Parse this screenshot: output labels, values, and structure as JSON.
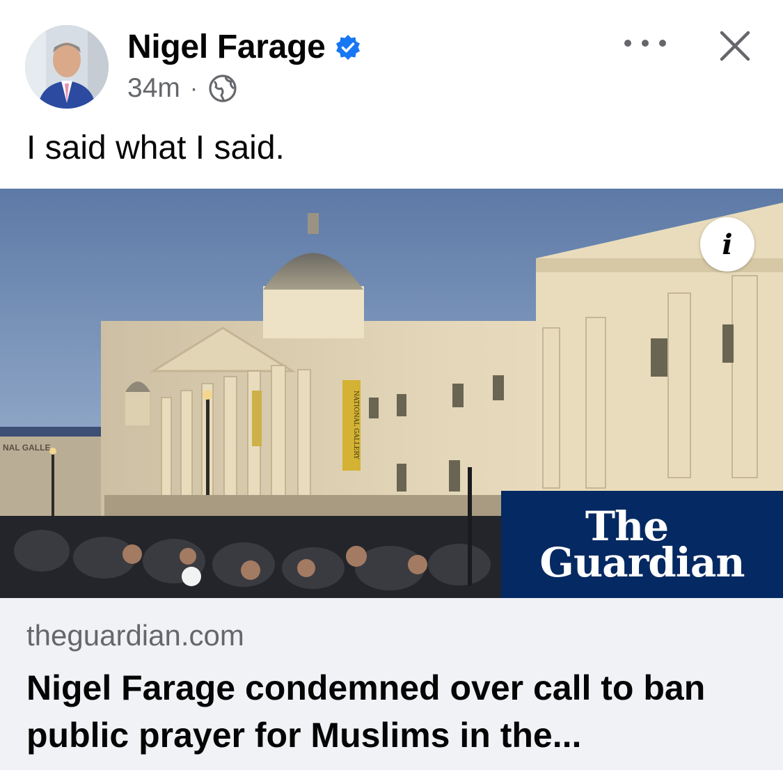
{
  "post": {
    "author": "Nigel Farage",
    "timestamp": "34m",
    "separator": "·",
    "audience_icon": "globe-icon",
    "caption": "I said what I said.",
    "verified_color": "#1877f2"
  },
  "link_preview": {
    "domain": "theguardian.com",
    "headline": "Nigel Farage condemned over call to ban public prayer for Muslims in the...",
    "info_icon": "i",
    "publisher_logo": {
      "line1": "The",
      "line2": "Guardian",
      "background": "#052962"
    }
  },
  "image_signage": {
    "banner_left": "NAL GALLE",
    "vertical_banner": "NATIONAL GALLERY"
  }
}
